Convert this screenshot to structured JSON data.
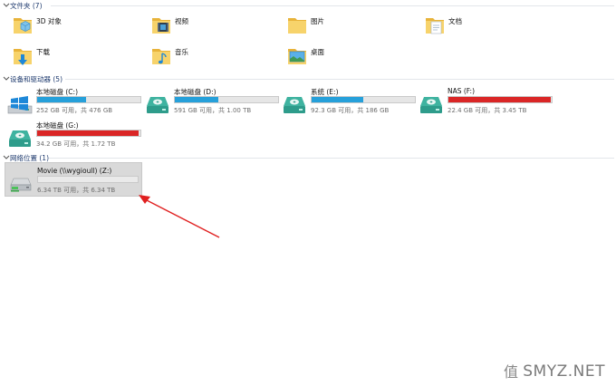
{
  "sections": {
    "folders": {
      "title": "文件夹 (7)"
    },
    "devices": {
      "title": "设备和驱动器 (5)"
    },
    "network": {
      "title": "网络位置 (1)"
    }
  },
  "folders": [
    {
      "label": "3D 对象",
      "icon": "3d-objects-icon"
    },
    {
      "label": "视频",
      "icon": "videos-icon"
    },
    {
      "label": "图片",
      "icon": "pictures-icon"
    },
    {
      "label": "文档",
      "icon": "documents-icon"
    },
    {
      "label": "下载",
      "icon": "downloads-icon"
    },
    {
      "label": "音乐",
      "icon": "music-icon"
    },
    {
      "label": "桌面",
      "icon": "desktop-icon"
    }
  ],
  "drives": [
    {
      "name": "本地磁盘 (C:)",
      "free": "252 GB 可用，共 476 GB",
      "used_fraction": 0.47,
      "status": "normal",
      "icon": "windows-drive-icon"
    },
    {
      "name": "本地磁盘 (D:)",
      "free": "591 GB 可用，共 1.00 TB",
      "used_fraction": 0.42,
      "status": "normal",
      "icon": "hard-drive-icon"
    },
    {
      "name": "系统 (E:)",
      "free": "92.3 GB 可用，共 186 GB",
      "used_fraction": 0.5,
      "status": "normal",
      "icon": "hard-drive-icon"
    },
    {
      "name": "NAS (F:)",
      "free": "22.4 GB 可用，共 3.45 TB",
      "used_fraction": 0.99,
      "status": "full",
      "icon": "hard-drive-icon"
    },
    {
      "name": "本地磁盘 (G:)",
      "free": "34.2 GB 可用，共 1.72 TB",
      "used_fraction": 0.98,
      "status": "full",
      "icon": "hard-drive-icon"
    }
  ],
  "network_locations": [
    {
      "name": "Movie (\\\\wygioull) (Z:)",
      "free": "6.34 TB 可用，共 6.34 TB",
      "used_fraction": 0.0,
      "icon": "network-drive-icon"
    }
  ],
  "colors": {
    "accent": "#26a0da",
    "full": "#da2626",
    "arrow": "#e02020",
    "selected": "#d9d9d9"
  },
  "watermark": {
    "text": "SMYZ.NET"
  }
}
